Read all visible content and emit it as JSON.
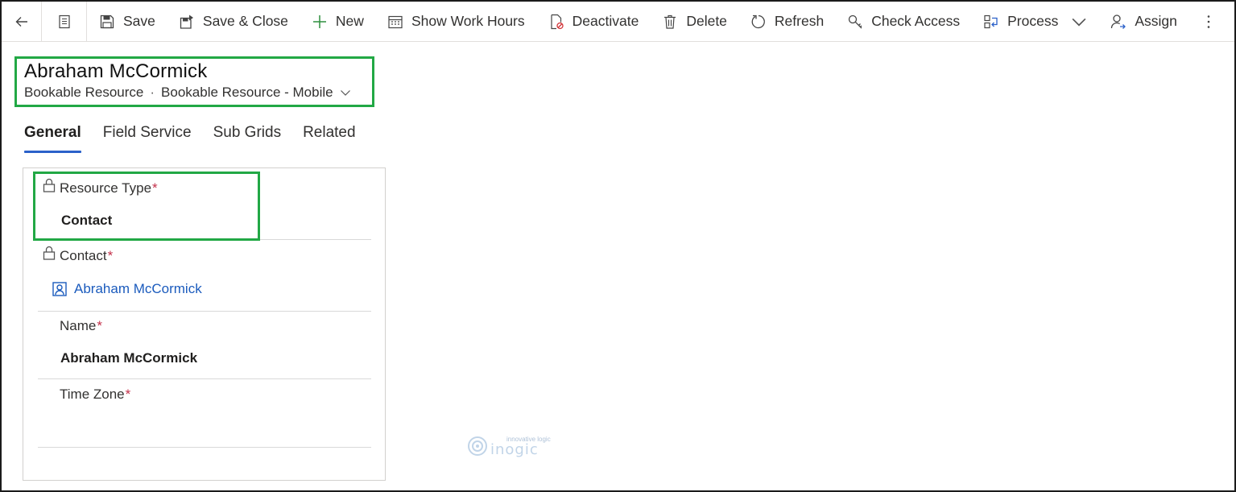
{
  "toolbar": {
    "save": "Save",
    "save_close": "Save & Close",
    "new": "New",
    "show_work_hours": "Show Work Hours",
    "deactivate": "Deactivate",
    "delete": "Delete",
    "refresh": "Refresh",
    "check_access": "Check Access",
    "process": "Process",
    "assign": "Assign"
  },
  "header": {
    "title": "Abraham McCormick",
    "entity": "Bookable Resource",
    "separator": "·",
    "form": "Bookable Resource - Mobile"
  },
  "tabs": [
    {
      "label": "General",
      "active": true
    },
    {
      "label": "Field Service",
      "active": false
    },
    {
      "label": "Sub Grids",
      "active": false
    },
    {
      "label": "Related",
      "active": false
    }
  ],
  "fields": {
    "resource_type": {
      "label": "Resource Type",
      "required": "*",
      "value": "Contact"
    },
    "contact": {
      "label": "Contact",
      "required": "*",
      "value": "Abraham McCormick"
    },
    "name": {
      "label": "Name",
      "required": "*",
      "value": "Abraham McCormick"
    },
    "time_zone": {
      "label": "Time Zone",
      "required": "*",
      "value": ""
    }
  },
  "watermark": {
    "tagline": "innovative logic",
    "brand": "inogic"
  },
  "colors": {
    "accent": "#2b61c9",
    "link": "#1b5bbd",
    "required": "#c4314b",
    "highlight": "#22a845"
  },
  "icons": [
    "back-arrow-icon",
    "form-icon",
    "save-icon",
    "save-close-icon",
    "plus-icon",
    "calendar-icon",
    "deactivate-icon",
    "trash-icon",
    "refresh-icon",
    "key-icon",
    "process-icon",
    "chevron-down-icon",
    "assign-icon",
    "more-icon",
    "lock-icon",
    "contact-card-icon"
  ]
}
